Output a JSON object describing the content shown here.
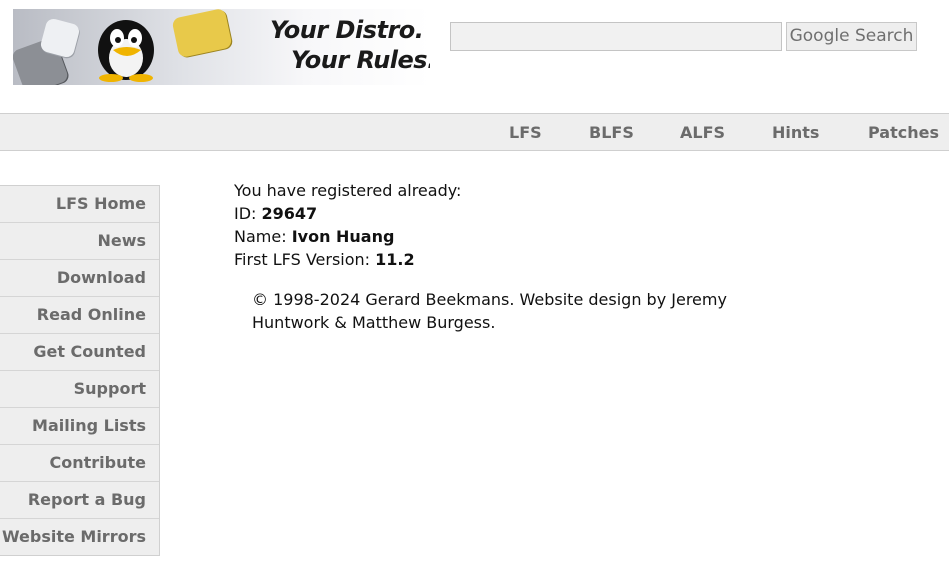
{
  "header": {
    "banner": {
      "tagline_line1": "Your Distro.",
      "tagline_line2": "Your Rules."
    },
    "search": {
      "input_value": "",
      "button_label": "Google Search"
    }
  },
  "topnav": {
    "items": [
      {
        "label": "LFS"
      },
      {
        "label": "BLFS"
      },
      {
        "label": "ALFS"
      },
      {
        "label": "Hints"
      },
      {
        "label": "Patches"
      }
    ]
  },
  "sidebar": {
    "items": [
      {
        "label": "LFS Home"
      },
      {
        "label": "News"
      },
      {
        "label": "Download"
      },
      {
        "label": "Read Online"
      },
      {
        "label": "Get Counted"
      },
      {
        "label": "Support"
      },
      {
        "label": "Mailing Lists"
      },
      {
        "label": "Contribute"
      },
      {
        "label": "Report a Bug"
      },
      {
        "label": "Website Mirrors"
      }
    ]
  },
  "main": {
    "message": "You have registered already:",
    "id_label": "ID: ",
    "id_value": "29647",
    "name_label": "Name: ",
    "name_value": "Ivon Huang",
    "version_label": "First LFS Version: ",
    "version_value": "11.2"
  },
  "footer": {
    "copyright": "© 1998-2024 Gerard Beekmans. Website design by Jeremy Huntwork & Matthew Burgess."
  }
}
